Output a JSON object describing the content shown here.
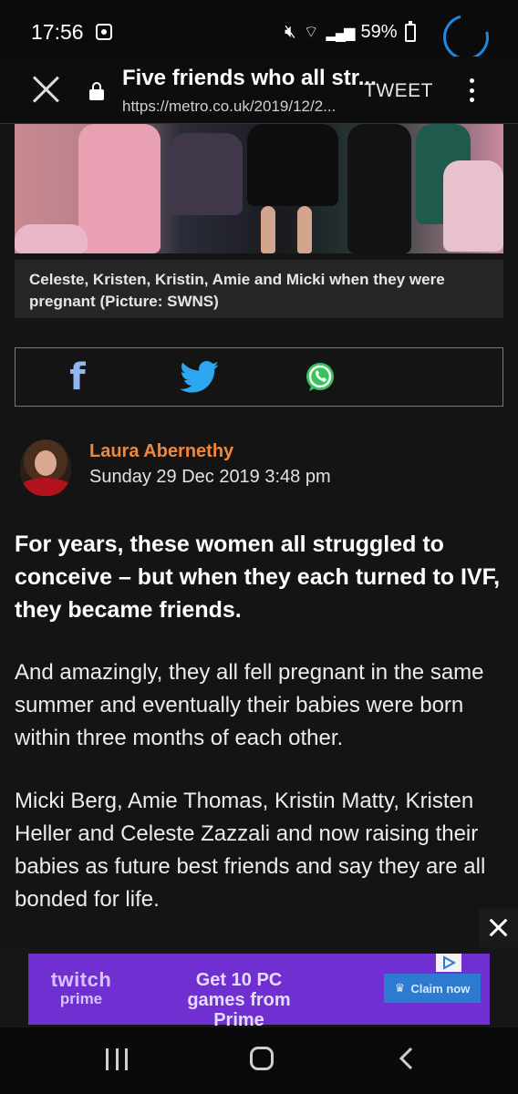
{
  "status_bar": {
    "time": "17:56",
    "battery": "59%",
    "accent_color": "#1e88e5"
  },
  "toolbar": {
    "title": "Five friends who all str...",
    "url": "https://metro.co.uk/2019/12/2...",
    "tweet_label": "TWEET"
  },
  "article": {
    "caption": "Celeste, Kristen, Kristin, Amie and Micki when they were pregnant (Picture: SWNS)",
    "share": {
      "facebook_glyph": "f",
      "facebook_color": "#8fb6f5",
      "twitter_color": "#2ea7f2",
      "whatsapp_color": "#38c45d"
    },
    "author": {
      "name": "Laura Abernethy",
      "date": "Sunday 29 Dec 2019 3:48 pm",
      "name_color": "#f2873a"
    },
    "lead": "For years, these women all struggled to conceive – but when they each turned to IVF, they became friends.",
    "paragraphs": [
      "And amazingly, they all fell pregnant in the same summer and eventually their babies were born within three months of each other.",
      "Micki Berg, Amie Thomas, Kristin Matty, Kristen Heller and Celeste Zazzali and now raising their babies as future best friends and say they are all bonded for life."
    ]
  },
  "ad": {
    "logo_line1": "twitch",
    "logo_line2": "prime",
    "text": "Get 10 PC games from Prime",
    "cta": "Claim now",
    "bg_color": "#6f2fd1"
  }
}
